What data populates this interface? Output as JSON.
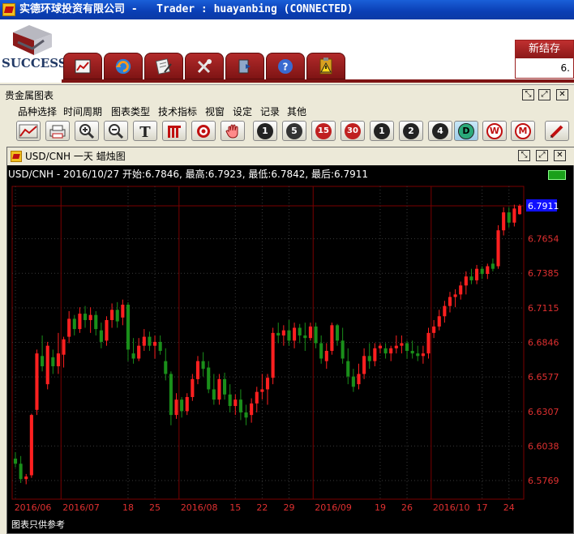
{
  "window": {
    "title": "实德环球投资有限公司 -   Trader : huayanbing (CONNECTED)"
  },
  "header": {
    "logo_text": "SUCCESS",
    "nav_icons": [
      "chart-line-icon",
      "refresh-icon",
      "document-edit-icon",
      "tools-icon",
      "exit-door-icon",
      "help-icon",
      "clipboard-warning-icon"
    ],
    "new_settle": {
      "label": "新结存",
      "value": "6."
    }
  },
  "panel": {
    "title": "贵金属图表",
    "menu": [
      "品种选择",
      "时间周期",
      "图表类型",
      "技术指标",
      "视窗",
      "设定",
      "记录",
      "其他"
    ],
    "toolbar": {
      "tools": [
        "line-chart-icon",
        "printer-icon",
        "zoom-in-icon",
        "zoom-out-icon",
        "text-tool-icon",
        "bar-chart-icon",
        "target-icon",
        "hand-icon"
      ],
      "periods": [
        "1",
        "5",
        "15",
        "30",
        "1",
        "2",
        "4",
        "D",
        "W",
        "M"
      ],
      "active_period": "D",
      "pen": "pen-icon"
    }
  },
  "chart_window": {
    "title": "USD/CNH 一天 蜡烛图",
    "info": "USD/CNH - 2016/10/27 开始:6.7846, 最高:6.7923, 最低:6.7842, 最后:6.7911",
    "footnote": "图表只供参考",
    "colors": {
      "up": "#ff2020",
      "down": "#1a8f1a",
      "grid": "#7a0000",
      "price_tag": "#1010ff",
      "axis_text": "#e03030"
    }
  },
  "chart_data": {
    "type": "candlestick",
    "ylim": [
      6.5675,
      6.7911
    ],
    "y_ticks": [
      6.7911,
      6.7654,
      6.7385,
      6.7115,
      6.6846,
      6.6577,
      6.6307,
      6.6038,
      6.5769
    ],
    "last_price": 6.7911,
    "x_ticks": [
      {
        "label": "2016/06",
        "bar": 0
      },
      {
        "label": "2016/07",
        "bar": 9
      },
      {
        "label": "18",
        "bar": 21
      },
      {
        "label": "25",
        "bar": 26
      },
      {
        "label": "2016/08",
        "bar": 31
      },
      {
        "label": "15",
        "bar": 41
      },
      {
        "label": "22",
        "bar": 46
      },
      {
        "label": "29",
        "bar": 51
      },
      {
        "label": "2016/09",
        "bar": 56
      },
      {
        "label": "19",
        "bar": 68
      },
      {
        "label": "26",
        "bar": 73
      },
      {
        "label": "2016/10",
        "bar": 78
      },
      {
        "label": "17",
        "bar": 87
      },
      {
        "label": "24",
        "bar": 92
      }
    ],
    "month_separators": [
      9,
      31,
      56,
      78
    ],
    "candles": [
      [
        6.594,
        6.599,
        6.587,
        6.59
      ],
      [
        6.59,
        6.596,
        6.575,
        6.578
      ],
      [
        6.578,
        6.582,
        6.574,
        6.58
      ],
      [
        6.581,
        6.629,
        6.579,
        6.628
      ],
      [
        6.632,
        6.679,
        6.628,
        6.676
      ],
      [
        6.674,
        6.69,
        6.662,
        6.666
      ],
      [
        6.652,
        6.685,
        6.648,
        6.682
      ],
      [
        6.673,
        6.679,
        6.66,
        6.666
      ],
      [
        6.666,
        6.692,
        6.66,
        6.676
      ],
      [
        6.675,
        6.689,
        6.665,
        6.687
      ],
      [
        6.689,
        6.709,
        6.684,
        6.703
      ],
      [
        6.703,
        6.706,
        6.69,
        6.695
      ],
      [
        6.695,
        6.712,
        6.692,
        6.707
      ],
      [
        6.707,
        6.713,
        6.696,
        6.702
      ],
      [
        6.702,
        6.712,
        6.692,
        6.706
      ],
      [
        6.706,
        6.709,
        6.69,
        6.695
      ],
      [
        6.694,
        6.7,
        6.68,
        6.685
      ],
      [
        6.686,
        6.705,
        6.682,
        6.702
      ],
      [
        6.702,
        6.715,
        6.696,
        6.71
      ],
      [
        6.71,
        6.716,
        6.696,
        6.701
      ],
      [
        6.704,
        6.718,
        6.698,
        6.714
      ],
      [
        6.714,
        6.716,
        6.67,
        6.679
      ],
      [
        6.676,
        6.688,
        6.668,
        6.672
      ],
      [
        6.672,
        6.688,
        6.67,
        6.682
      ],
      [
        6.682,
        6.695,
        6.678,
        6.689
      ],
      [
        6.689,
        6.693,
        6.678,
        6.682
      ],
      [
        6.682,
        6.69,
        6.672,
        6.685
      ],
      [
        6.685,
        6.69,
        6.675,
        6.678
      ],
      [
        6.67,
        6.68,
        6.655,
        6.66
      ],
      [
        6.66,
        6.662,
        6.62,
        6.628
      ],
      [
        6.628,
        6.645,
        6.625,
        6.64
      ],
      [
        6.64,
        6.642,
        6.626,
        6.631
      ],
      [
        6.631,
        6.645,
        6.628,
        6.642
      ],
      [
        6.642,
        6.66,
        6.639,
        6.656
      ],
      [
        6.656,
        6.674,
        6.652,
        6.67
      ],
      [
        6.67,
        6.677,
        6.658,
        6.664
      ],
      [
        6.665,
        6.67,
        6.645,
        6.648
      ],
      [
        6.648,
        6.66,
        6.636,
        6.64
      ],
      [
        6.64,
        6.66,
        6.636,
        6.656
      ],
      [
        6.656,
        6.661,
        6.64,
        6.644
      ],
      [
        6.644,
        6.652,
        6.63,
        6.635
      ],
      [
        6.635,
        6.644,
        6.628,
        6.64
      ],
      [
        6.64,
        6.648,
        6.624,
        6.63
      ],
      [
        6.63,
        6.636,
        6.62,
        6.626
      ],
      [
        6.628,
        6.641,
        6.622,
        6.637
      ],
      [
        6.637,
        6.65,
        6.63,
        6.646
      ],
      [
        6.646,
        6.66,
        6.64,
        6.648
      ],
      [
        6.648,
        6.66,
        6.636,
        6.657
      ],
      [
        6.657,
        6.696,
        6.652,
        6.692
      ],
      [
        6.692,
        6.7,
        6.684,
        6.69
      ],
      [
        6.69,
        6.698,
        6.682,
        6.694
      ],
      [
        6.694,
        6.702,
        6.682,
        6.686
      ],
      [
        6.686,
        6.7,
        6.68,
        6.696
      ],
      [
        6.696,
        6.699,
        6.684,
        6.69
      ],
      [
        6.69,
        6.7,
        6.678,
        6.688
      ],
      [
        6.688,
        6.7,
        6.686,
        6.697
      ],
      [
        6.697,
        6.7,
        6.68,
        6.684
      ],
      [
        6.684,
        6.69,
        6.668,
        6.672
      ],
      [
        6.67,
        6.684,
        6.664,
        6.678
      ],
      [
        6.678,
        6.7,
        6.675,
        6.698
      ],
      [
        6.698,
        6.699,
        6.682,
        6.686
      ],
      [
        6.686,
        6.696,
        6.668,
        6.672
      ],
      [
        6.67,
        6.68,
        6.652,
        6.658
      ],
      [
        6.658,
        6.664,
        6.646,
        6.65
      ],
      [
        6.652,
        6.668,
        6.648,
        6.66
      ],
      [
        6.66,
        6.68,
        6.656,
        6.674
      ],
      [
        6.674,
        6.684,
        6.664,
        6.67
      ],
      [
        6.67,
        6.684,
        6.666,
        6.68
      ],
      [
        6.68,
        6.684,
        6.676,
        6.682
      ],
      [
        6.68,
        6.684,
        6.672,
        6.676
      ],
      [
        6.676,
        6.682,
        6.67,
        6.68
      ],
      [
        6.68,
        6.69,
        6.676,
        6.682
      ],
      [
        6.682,
        6.69,
        6.676,
        6.684
      ],
      [
        6.684,
        6.686,
        6.672,
        6.678
      ],
      [
        6.678,
        6.686,
        6.672,
        6.676
      ],
      [
        6.676,
        6.682,
        6.67,
        6.674
      ],
      [
        6.674,
        6.682,
        6.668,
        6.676
      ],
      [
        6.676,
        6.696,
        6.672,
        6.692
      ],
      [
        6.692,
        6.702,
        6.688,
        6.697
      ],
      [
        6.697,
        6.71,
        6.694,
        6.705
      ],
      [
        6.705,
        6.717,
        6.7,
        6.713
      ],
      [
        6.713,
        6.724,
        6.708,
        6.72
      ],
      [
        6.72,
        6.726,
        6.712,
        6.722
      ],
      [
        6.722,
        6.732,
        6.718,
        6.729
      ],
      [
        6.729,
        6.74,
        6.722,
        6.736
      ],
      [
        6.736,
        6.742,
        6.73,
        6.733
      ],
      [
        6.733,
        6.745,
        6.73,
        6.742
      ],
      [
        6.742,
        6.744,
        6.734,
        6.738
      ],
      [
        6.738,
        6.746,
        6.734,
        6.744
      ],
      [
        6.746,
        6.75,
        6.74,
        6.742
      ],
      [
        6.744,
        6.776,
        6.742,
        6.772
      ],
      [
        6.772,
        6.79,
        6.768,
        6.786
      ],
      [
        6.786,
        6.79,
        6.774,
        6.778
      ],
      [
        6.778,
        6.792,
        6.775,
        6.789
      ],
      [
        6.7846,
        6.7923,
        6.7842,
        6.7911
      ]
    ]
  }
}
